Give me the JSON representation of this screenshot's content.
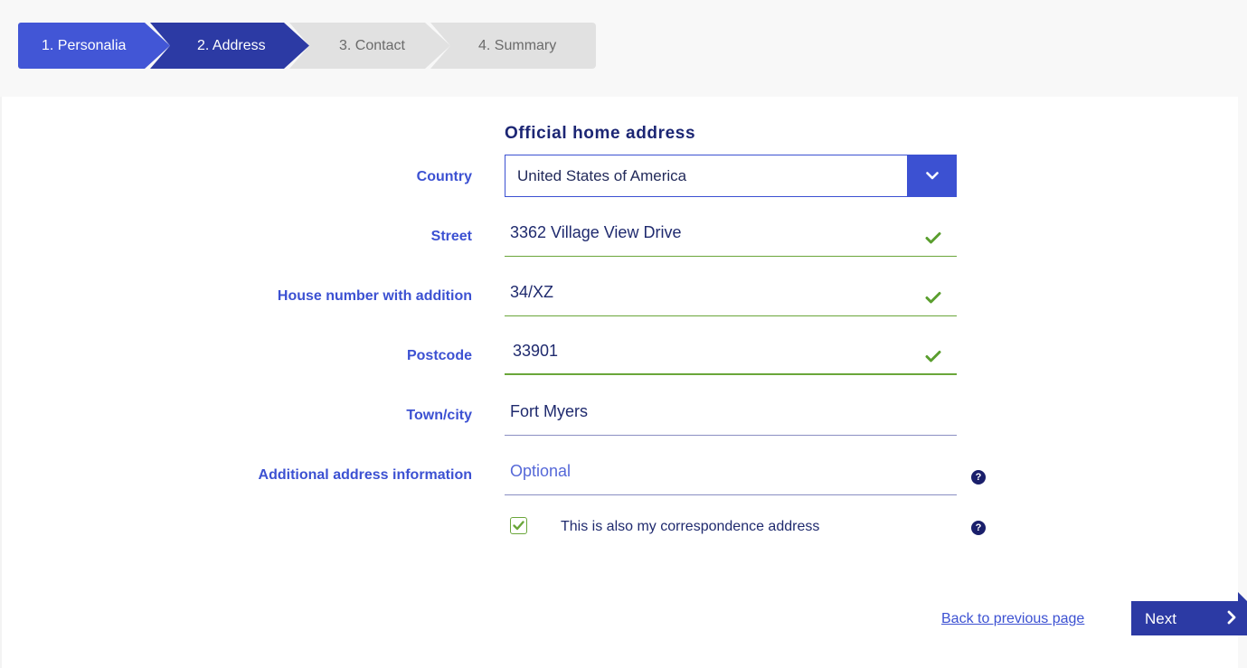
{
  "stepper": {
    "steps": [
      {
        "label": "1. Personalia",
        "state": "completed"
      },
      {
        "label": "2. Address",
        "state": "active"
      },
      {
        "label": "3. Contact",
        "state": "upcoming"
      },
      {
        "label": "4. Summary",
        "state": "upcoming"
      }
    ]
  },
  "form": {
    "section_title": "Official home address",
    "country": {
      "label": "Country",
      "value": "United States of America"
    },
    "street": {
      "label": "Street",
      "value": "3362 Village View Drive",
      "valid": true
    },
    "house_number": {
      "label": "House number with addition",
      "value": "34/XZ",
      "valid": true
    },
    "postcode": {
      "label": "Postcode",
      "value": "33901",
      "valid": true
    },
    "town": {
      "label": "Town/city",
      "value": "Fort Myers"
    },
    "additional": {
      "label": "Additional address information",
      "value": "",
      "placeholder": "Optional"
    },
    "correspondence": {
      "label": "This is also my correspondence address",
      "checked": true
    }
  },
  "footer": {
    "back_label": "Back to previous page",
    "next_label": "Next"
  },
  "colors": {
    "primary": "#3c51d2",
    "primary_dark": "#2c3aa4",
    "navy_text": "#1c2674",
    "valid_green": "#6aa63a",
    "inactive_step": "#e1e1e1"
  },
  "icons": {
    "dropdown": "chevron-down-icon",
    "valid": "check-icon",
    "help": "question-circle-icon",
    "next": "chevron-right-icon"
  }
}
